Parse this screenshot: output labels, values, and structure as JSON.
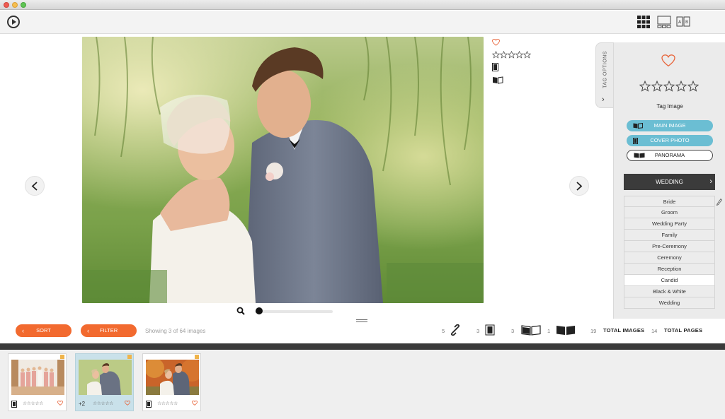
{
  "toolbar": {
    "play_icon": "play-circle-icon",
    "views": [
      "grid-view-icon",
      "single-view-icon",
      "compare-view-icon"
    ]
  },
  "viewer": {
    "prev_icon": "chevron-left-icon",
    "next_icon": "chevron-right-icon",
    "zoom": 0.0
  },
  "tag_panel": {
    "tab_label": "TAG OPTIONS",
    "tag_image_label": "Tag Image",
    "main_image_label": "MAIN IMAGE",
    "cover_photo_label": "COVER PHOTO",
    "panorama_label": "PANORAMA",
    "category": "WEDDING",
    "tags": [
      "Bride",
      "Groom",
      "Wedding Party",
      "Family",
      "Pre-Ceremony",
      "Ceremony",
      "Reception",
      "Candid",
      "Black & White",
      "Wedding"
    ],
    "selected_tag": "Candid",
    "rating": 0,
    "max_rating": 5
  },
  "bottom_bar": {
    "sort_label": "SORT",
    "filter_label": "FILTER",
    "showing_text": "Showing 3 of 64 images",
    "stats": {
      "linked_count": "5",
      "single_count": "3",
      "spread_count": "3",
      "panorama_count": "1",
      "total_images_count": "19",
      "total_images_label": "TOTAL IMAGES",
      "total_pages_count": "14",
      "total_pages_label": "TOTAL PAGES"
    }
  },
  "filmstrip": {
    "thumbs": [
      {
        "extra": "",
        "stars": "☆☆☆☆☆"
      },
      {
        "extra": "+2",
        "stars": "☆☆☆☆☆"
      },
      {
        "extra": "",
        "stars": "☆☆☆☆☆"
      }
    ]
  },
  "colors": {
    "accent_orange": "#f26a2f",
    "accent_blue": "#6bbed3",
    "heart": "#e8643a",
    "dark_header": "#3b3b3b"
  }
}
